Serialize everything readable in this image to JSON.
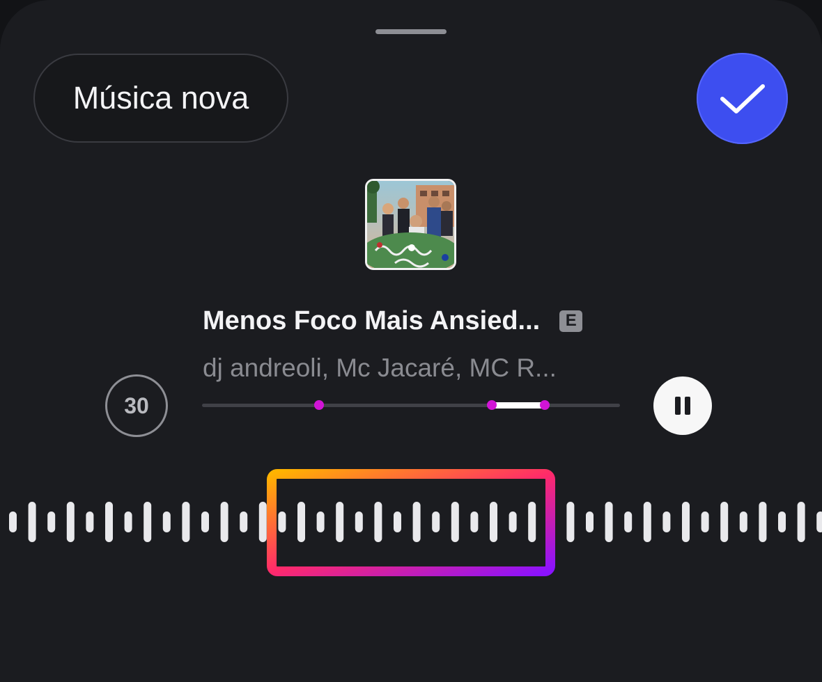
{
  "header": {
    "new_music_label": "Música nova",
    "confirm_icon": "checkmark-icon"
  },
  "track": {
    "title": "Menos Foco Mais Ansied...",
    "explicit_badge": "E",
    "artists": "dj andreoli, Mc Jacaré, MC R...",
    "cover_art_icon": "album-cover-image"
  },
  "controls": {
    "duration_label": "30",
    "playback_icon": "pause-icon",
    "progress_fraction": 0.82
  },
  "colors": {
    "accent_confirm": "#3d4ef0",
    "marker": "#d114d6",
    "frame_gradient": [
      "#ffb300",
      "#ff2a6a",
      "#8a12ff"
    ]
  }
}
